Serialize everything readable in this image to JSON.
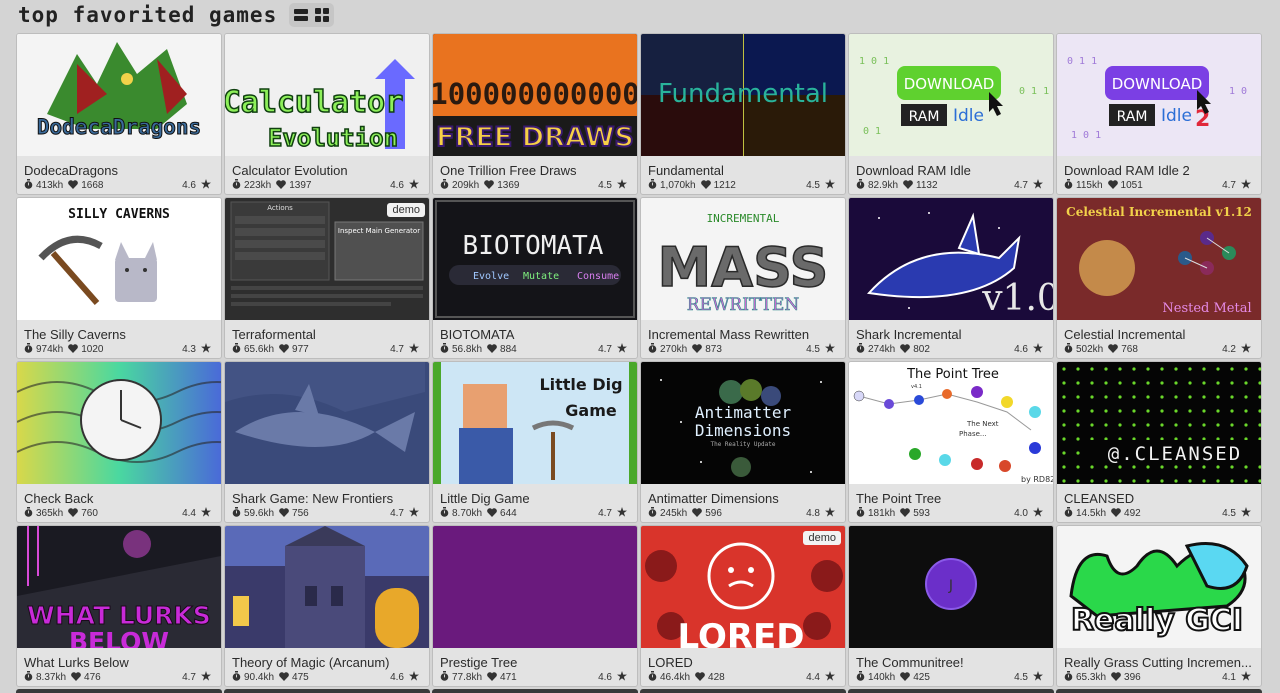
{
  "header": {
    "title": "top favorited games"
  },
  "icons": {
    "list_view": "list-view-icon",
    "grid_view": "grid-view-icon",
    "time": "stopwatch-icon",
    "favorites": "heart-icon",
    "rating": "star-icon"
  },
  "games": [
    {
      "title": "DodecaDragons",
      "time": "413kh",
      "favorites": "1668",
      "rating": "4.6"
    },
    {
      "title": "Calculator Evolution",
      "time": "223kh",
      "favorites": "1397",
      "rating": "4.6"
    },
    {
      "title": "One Trillion Free Draws",
      "time": "209kh",
      "favorites": "1369",
      "rating": "4.5"
    },
    {
      "title": "Fundamental",
      "time": "1,070kh",
      "favorites": "1212",
      "rating": "4.5"
    },
    {
      "title": "Download RAM Idle",
      "time": "82.9kh",
      "favorites": "1132",
      "rating": "4.7"
    },
    {
      "title": "Download RAM Idle 2",
      "time": "115kh",
      "favorites": "1051",
      "rating": "4.7"
    },
    {
      "title": "The Silly Caverns",
      "time": "974kh",
      "favorites": "1020",
      "rating": "4.3"
    },
    {
      "title": "Terraformental",
      "time": "65.6kh",
      "favorites": "977",
      "rating": "4.7",
      "badge": "demo"
    },
    {
      "title": "BIOTOMATA",
      "time": "56.8kh",
      "favorites": "884",
      "rating": "4.7"
    },
    {
      "title": "Incremental Mass Rewritten",
      "time": "270kh",
      "favorites": "873",
      "rating": "4.5"
    },
    {
      "title": "Shark Incremental",
      "time": "274kh",
      "favorites": "802",
      "rating": "4.6"
    },
    {
      "title": "Celestial Incremental",
      "time": "502kh",
      "favorites": "768",
      "rating": "4.2"
    },
    {
      "title": "Check Back",
      "time": "365kh",
      "favorites": "760",
      "rating": "4.4"
    },
    {
      "title": "Shark Game: New Frontiers",
      "time": "59.6kh",
      "favorites": "756",
      "rating": "4.7"
    },
    {
      "title": "Little Dig Game",
      "time": "8.70kh",
      "favorites": "644",
      "rating": "4.7"
    },
    {
      "title": "Antimatter Dimensions",
      "time": "245kh",
      "favorites": "596",
      "rating": "4.8"
    },
    {
      "title": "The Point Tree",
      "time": "181kh",
      "favorites": "593",
      "rating": "4.0"
    },
    {
      "title": "CLEANSED",
      "time": "14.5kh",
      "favorites": "492",
      "rating": "4.5"
    },
    {
      "title": "What Lurks Below",
      "time": "8.37kh",
      "favorites": "476",
      "rating": "4.7"
    },
    {
      "title": "Theory of Magic (Arcanum)",
      "time": "90.4kh",
      "favorites": "475",
      "rating": "4.6"
    },
    {
      "title": "Prestige Tree",
      "time": "77.8kh",
      "favorites": "471",
      "rating": "4.6"
    },
    {
      "title": "LORED",
      "time": "46.4kh",
      "favorites": "428",
      "rating": "4.4",
      "badge": "demo"
    },
    {
      "title": "The Communitree!",
      "time": "140kh",
      "favorites": "425",
      "rating": "4.5"
    },
    {
      "title": "Really Grass Cutting Incremen...",
      "time": "65.3kh",
      "favorites": "396",
      "rating": "4.1"
    }
  ],
  "thumb_text": {
    "t0": "DodecaDragons",
    "t1a": "Calculator",
    "t1b": "Evolution",
    "t2a": "100000000000",
    "t2b": "FREE DRAWS",
    "t3": "Fundamental",
    "t4a": "DOWNLOAD",
    "t4b": "RAM",
    "t4c": "Idle",
    "t5a": "DOWNLOAD",
    "t5b": "RAM",
    "t5c": "Idle",
    "t5d": "2",
    "t6": "SILLY CAVERNS",
    "t7a": "Actions",
    "t7b": "Inspect Main Generator",
    "t8a": "BIOTOMATA",
    "t8b": "Evolve",
    "t8c": "Mutate",
    "t8d": "Consume",
    "t9a": "INCREMENTAL",
    "t9b": "MASS",
    "t9c": "REWRITTEN",
    "t10": "v1.0",
    "t11a": "Celestial Incremental v1.12",
    "t11b": "Nested Metal",
    "t14a": "Little Dig",
    "t14b": "Game",
    "t15a": "Antimatter",
    "t15b": "Dimensions",
    "t15c": "The Reality Update",
    "t16a": "The Point Tree",
    "t16b": "v4.1",
    "t16c": "The Next",
    "t16d": "Phase...",
    "t16e": "by RD82",
    "t17": "@.CLEANSED",
    "t18a": "WHAT LURKS",
    "t18b": "BELOW",
    "t21": "LORED",
    "t22": "J",
    "t23": "Really GCI"
  },
  "colors": {
    "page_bg": "#d4d4d4",
    "card_bg": "#e3e3e3",
    "prestige_purple": "#6a1a7d",
    "lored_red": "#d9342b",
    "communitree_purple": "#6b2fc9"
  }
}
